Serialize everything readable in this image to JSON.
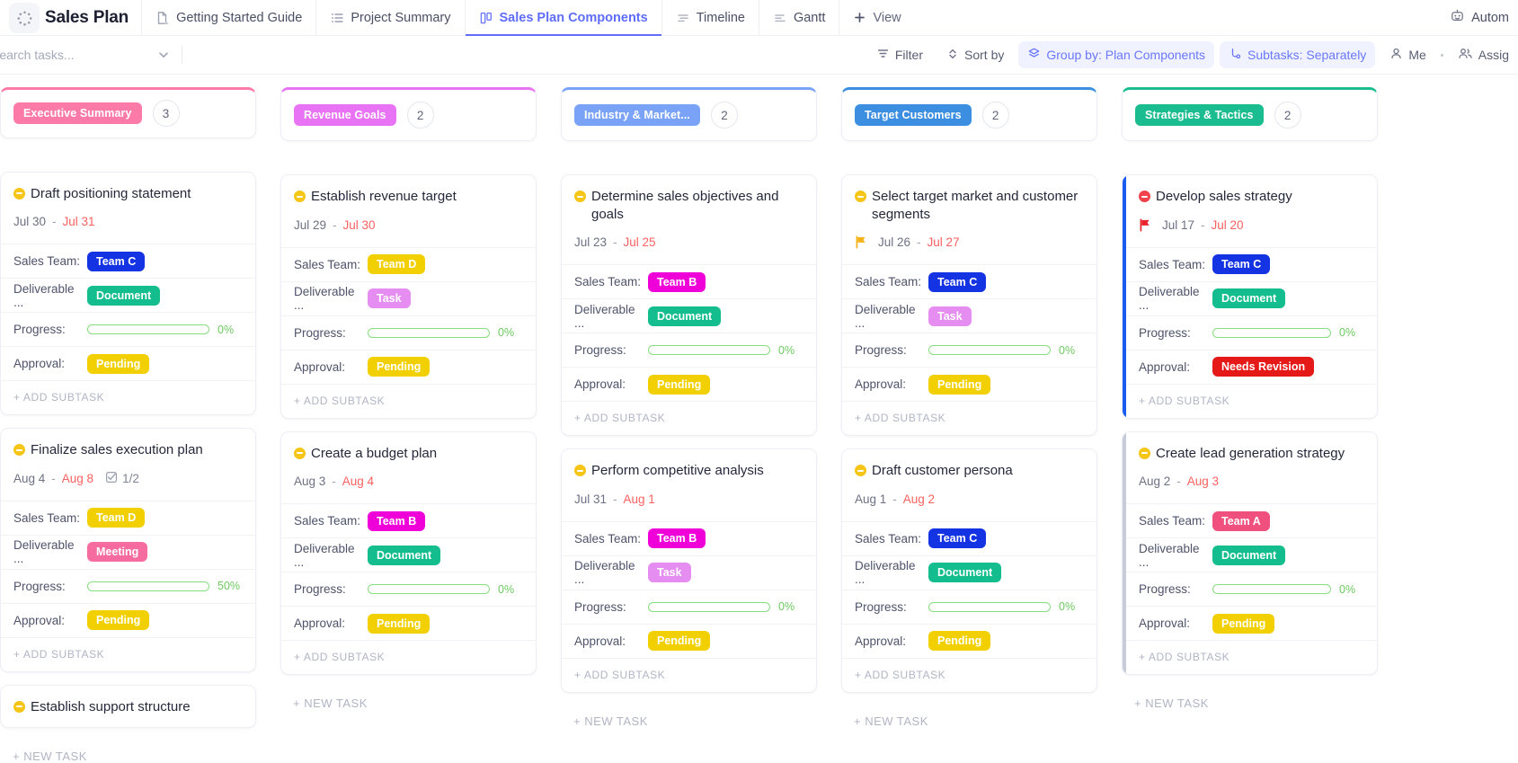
{
  "topbar": {
    "app_title": "Sales Plan",
    "app_icon": "dotted-circle-icon",
    "tabs": [
      {
        "label": "Getting Started Guide",
        "icon": "doc-home-icon",
        "active": false
      },
      {
        "label": "Project Summary",
        "icon": "list-icon",
        "active": false
      },
      {
        "label": "Sales Plan Components",
        "icon": "board-icon",
        "active": true
      },
      {
        "label": "Timeline",
        "icon": "timeline-icon",
        "active": false
      },
      {
        "label": "Gantt",
        "icon": "gantt-icon",
        "active": false
      }
    ],
    "add_view_label": "View",
    "automations_label": "Autom",
    "automations_icon": "robot-icon"
  },
  "toolbar": {
    "search_placeholder": "Search tasks...",
    "search_value": "",
    "chevron_icon": "chevron-down-icon",
    "filter_label": "Filter",
    "filter_icon": "filter-icon",
    "sort_label": "Sort by",
    "sort_icon": "sort-icon",
    "group_label": "Group by: Plan Components",
    "group_icon": "layers-icon",
    "subtasks_label": "Subtasks: Separately",
    "subtasks_icon": "subtask-icon",
    "me_label": "Me",
    "me_icon": "person-icon",
    "assignees_label": "Assig",
    "assignees_icon": "people-icon"
  },
  "colors": {
    "executive_summary": "#fb7aa8",
    "revenue_goals": "#e874f5",
    "industry_market": "#7aa2f7",
    "target_customers": "#3b8ee0",
    "strategies_tactics": "#1bbc8f",
    "team_a": "#f0507e",
    "team_b": "#ef00d9",
    "team_c": "#1433e2",
    "team_d": "#f2d000",
    "document": "#14bd8d",
    "task": "#e58df0",
    "meeting": "#f76ca0",
    "pending": "#f2d000",
    "needs_revision": "#e61919",
    "status_yellow": "#f5c518",
    "status_red": "#f0414c",
    "progress_green": "#5ed14f"
  },
  "columns": [
    {
      "name": "Executive Summary",
      "color": "#fb7aa8",
      "count": "3",
      "add_label": "+ NEW TASK",
      "cards": [
        {
          "title": "Draft positioning statement",
          "status_color": "#f5c518",
          "left_border": "",
          "flag": "",
          "date_start": "Jul 30",
          "date_end": "Jul 31",
          "subtask_count": "",
          "rows": [
            {
              "label": "Sales Team:",
              "tag": "Team C",
              "tag_color": "#1433e2"
            },
            {
              "label": "Deliverable ...",
              "tag": "Document",
              "tag_color": "#14bd8d"
            }
          ],
          "progress_label": "Progress:",
          "progress": 0,
          "progress_text": "0%",
          "approval_label": "Approval:",
          "approval": "Pending",
          "approval_color": "#f2d000",
          "add_subtask": "+ ADD SUBTASK"
        },
        {
          "title": "Finalize sales execution plan",
          "status_color": "#f5c518",
          "left_border": "",
          "flag": "",
          "date_start": "Aug 4",
          "date_end": "Aug 8",
          "subtask_count": "1/2",
          "rows": [
            {
              "label": "Sales Team:",
              "tag": "Team D",
              "tag_color": "#f2d000"
            },
            {
              "label": "Deliverable ...",
              "tag": "Meeting",
              "tag_color": "#f76ca0"
            }
          ],
          "progress_label": "Progress:",
          "progress": 50,
          "progress_text": "50%",
          "approval_label": "Approval:",
          "approval": "Pending",
          "approval_color": "#f2d000",
          "add_subtask": "+ ADD SUBTASK"
        },
        {
          "title": "Establish support structure",
          "status_color": "#f5c518",
          "left_border": "",
          "flag": "",
          "date_start": "",
          "date_end": "",
          "subtask_count": "",
          "rows": [],
          "progress_label": "",
          "progress": 0,
          "progress_text": "",
          "approval_label": "",
          "approval": "",
          "approval_color": "",
          "add_subtask": ""
        }
      ]
    },
    {
      "name": "Revenue Goals",
      "color": "#e874f5",
      "count": "2",
      "add_label": "+ NEW TASK",
      "cards": [
        {
          "title": "Establish revenue target",
          "status_color": "#f5c518",
          "left_border": "",
          "flag": "",
          "date_start": "Jul 29",
          "date_end": "Jul 30",
          "subtask_count": "",
          "rows": [
            {
              "label": "Sales Team:",
              "tag": "Team D",
              "tag_color": "#f2d000"
            },
            {
              "label": "Deliverable ...",
              "tag": "Task",
              "tag_color": "#e58df0"
            }
          ],
          "progress_label": "Progress:",
          "progress": 0,
          "progress_text": "0%",
          "approval_label": "Approval:",
          "approval": "Pending",
          "approval_color": "#f2d000",
          "add_subtask": "+ ADD SUBTASK"
        },
        {
          "title": "Create a budget plan",
          "status_color": "#f5c518",
          "left_border": "",
          "flag": "",
          "date_start": "Aug 3",
          "date_end": "Aug 4",
          "subtask_count": "",
          "rows": [
            {
              "label": "Sales Team:",
              "tag": "Team B",
              "tag_color": "#ef00d9"
            },
            {
              "label": "Deliverable ...",
              "tag": "Document",
              "tag_color": "#14bd8d"
            }
          ],
          "progress_label": "Progress:",
          "progress": 0,
          "progress_text": "0%",
          "approval_label": "Approval:",
          "approval": "Pending",
          "approval_color": "#f2d000",
          "add_subtask": "+ ADD SUBTASK"
        }
      ]
    },
    {
      "name": "Industry & Market...",
      "color": "#7aa2f7",
      "count": "2",
      "add_label": "+ NEW TASK",
      "cards": [
        {
          "title": "Determine sales objectives and goals",
          "status_color": "#f5c518",
          "left_border": "",
          "flag": "",
          "date_start": "Jul 23",
          "date_end": "Jul 25",
          "subtask_count": "",
          "rows": [
            {
              "label": "Sales Team:",
              "tag": "Team B",
              "tag_color": "#ef00d9"
            },
            {
              "label": "Deliverable ...",
              "tag": "Document",
              "tag_color": "#14bd8d"
            }
          ],
          "progress_label": "Progress:",
          "progress": 0,
          "progress_text": "0%",
          "approval_label": "Approval:",
          "approval": "Pending",
          "approval_color": "#f2d000",
          "add_subtask": "+ ADD SUBTASK"
        },
        {
          "title": "Perform competitive analysis",
          "status_color": "#f5c518",
          "left_border": "",
          "flag": "",
          "date_start": "Jul 31",
          "date_end": "Aug 1",
          "subtask_count": "",
          "rows": [
            {
              "label": "Sales Team:",
              "tag": "Team B",
              "tag_color": "#ef00d9"
            },
            {
              "label": "Deliverable ...",
              "tag": "Task",
              "tag_color": "#e58df0"
            }
          ],
          "progress_label": "Progress:",
          "progress": 0,
          "progress_text": "0%",
          "approval_label": "Approval:",
          "approval": "Pending",
          "approval_color": "#f2d000",
          "add_subtask": "+ ADD SUBTASK"
        }
      ]
    },
    {
      "name": "Target Customers",
      "color": "#3b8ee0",
      "count": "2",
      "add_label": "+ NEW TASK",
      "cards": [
        {
          "title": "Select target market and customer segments",
          "status_color": "#f5c518",
          "left_border": "",
          "flag": "#f5b319",
          "date_start": "Jul 26",
          "date_end": "Jul 27",
          "subtask_count": "",
          "rows": [
            {
              "label": "Sales Team:",
              "tag": "Team C",
              "tag_color": "#1433e2"
            },
            {
              "label": "Deliverable ...",
              "tag": "Task",
              "tag_color": "#e58df0"
            }
          ],
          "progress_label": "Progress:",
          "progress": 0,
          "progress_text": "0%",
          "approval_label": "Approval:",
          "approval": "Pending",
          "approval_color": "#f2d000",
          "add_subtask": "+ ADD SUBTASK"
        },
        {
          "title": "Draft customer persona",
          "status_color": "#f5c518",
          "left_border": "",
          "flag": "",
          "date_start": "Aug 1",
          "date_end": "Aug 2",
          "subtask_count": "",
          "rows": [
            {
              "label": "Sales Team:",
              "tag": "Team C",
              "tag_color": "#1433e2"
            },
            {
              "label": "Deliverable ...",
              "tag": "Document",
              "tag_color": "#14bd8d"
            }
          ],
          "progress_label": "Progress:",
          "progress": 0,
          "progress_text": "0%",
          "approval_label": "Approval:",
          "approval": "Pending",
          "approval_color": "#f2d000",
          "add_subtask": "+ ADD SUBTASK"
        }
      ]
    },
    {
      "name": "Strategies & Tactics",
      "color": "#1bbc8f",
      "count": "2",
      "add_label": "+ NEW TASK",
      "cards": [
        {
          "title": "Develop sales strategy",
          "status_color": "#f0414c",
          "left_border": "#1b5cf0",
          "flag": "#e8232d",
          "date_start": "Jul 17",
          "date_end": "Jul 20",
          "subtask_count": "",
          "rows": [
            {
              "label": "Sales Team:",
              "tag": "Team C",
              "tag_color": "#1433e2"
            },
            {
              "label": "Deliverable ...",
              "tag": "Document",
              "tag_color": "#14bd8d"
            }
          ],
          "progress_label": "Progress:",
          "progress": 0,
          "progress_text": "0%",
          "approval_label": "Approval:",
          "approval": "Needs Revision",
          "approval_color": "#e61919",
          "add_subtask": "+ ADD SUBTASK"
        },
        {
          "title": "Create lead generation strategy",
          "status_color": "#f5c518",
          "left_border": "#c8ccd8",
          "flag": "",
          "date_start": "Aug 2",
          "date_end": "Aug 3",
          "subtask_count": "",
          "rows": [
            {
              "label": "Sales Team:",
              "tag": "Team A",
              "tag_color": "#f0507e"
            },
            {
              "label": "Deliverable ...",
              "tag": "Document",
              "tag_color": "#14bd8d"
            }
          ],
          "progress_label": "Progress:",
          "progress": 0,
          "progress_text": "0%",
          "approval_label": "Approval:",
          "approval": "Pending",
          "approval_color": "#f2d000",
          "add_subtask": "+ ADD SUBTASK"
        }
      ]
    }
  ]
}
